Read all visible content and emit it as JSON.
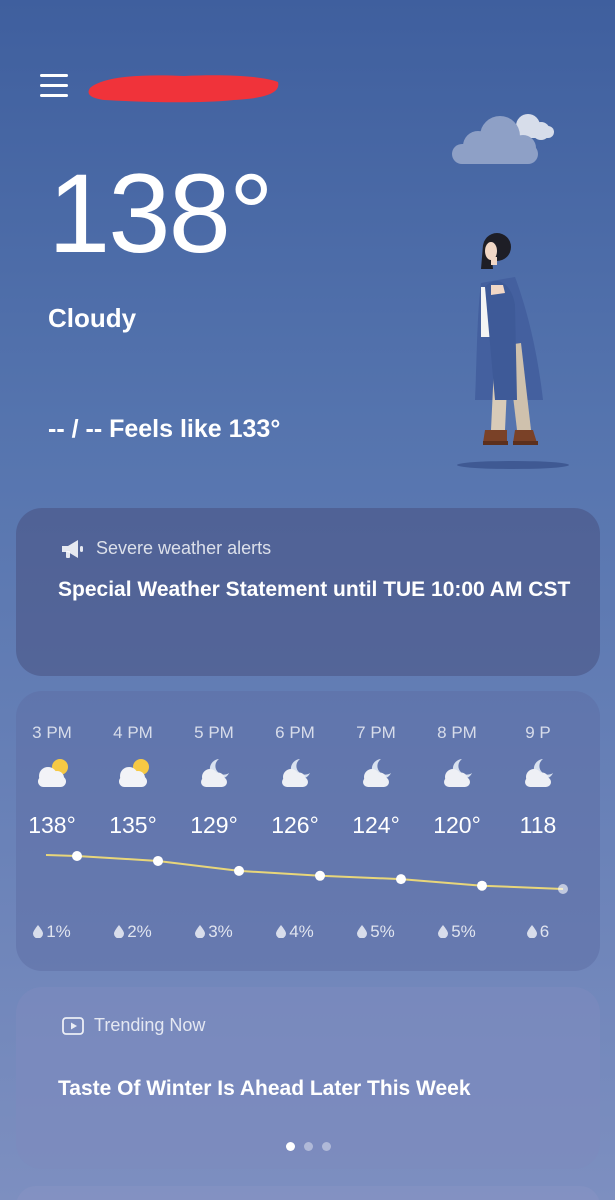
{
  "current": {
    "temperature": "138°",
    "condition": "Cloudy",
    "feels_like": "-- / -- Feels like 133°"
  },
  "alert": {
    "label": "Severe weather alerts",
    "text": "Special Weather Statement until TUE 10:00 AM CST"
  },
  "hourly": [
    {
      "time": "3 PM",
      "icon": "partly-cloudy-day-icon",
      "temp": "138°",
      "precip": "1%",
      "value": 138
    },
    {
      "time": "4 PM",
      "icon": "partly-cloudy-day-icon",
      "temp": "135°",
      "precip": "2%",
      "value": 135
    },
    {
      "time": "5 PM",
      "icon": "partly-cloudy-night-icon",
      "temp": "129°",
      "precip": "3%",
      "value": 129
    },
    {
      "time": "6 PM",
      "icon": "partly-cloudy-night-icon",
      "temp": "126°",
      "precip": "4%",
      "value": 126
    },
    {
      "time": "7 PM",
      "icon": "partly-cloudy-night-icon",
      "temp": "124°",
      "precip": "5%",
      "value": 124
    },
    {
      "time": "8 PM",
      "icon": "partly-cloudy-night-icon",
      "temp": "120°",
      "precip": "5%",
      "value": 120
    },
    {
      "time": "9 P",
      "icon": "partly-cloudy-night-icon",
      "temp": "118",
      "precip": "6",
      "value": 118
    }
  ],
  "trending": {
    "label": "Trending Now",
    "title": "Taste Of Winter Is Ahead Later This Week",
    "active_page": 1,
    "page_count": 3
  },
  "colors": {
    "accent_line": "#e8d67a",
    "redaction": "#f0333a"
  }
}
